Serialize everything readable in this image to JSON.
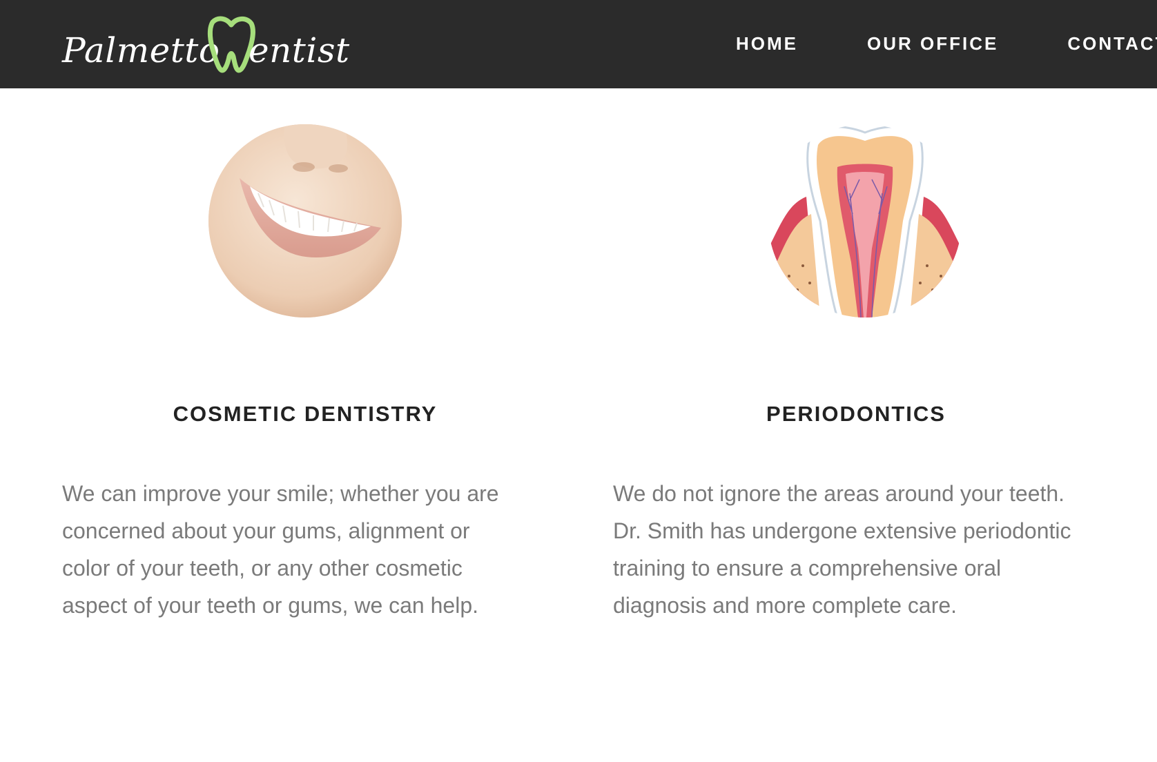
{
  "header": {
    "logo": {
      "text_part1": "Palmetto",
      "text_part2": "entist",
      "icon": "tooth-icon",
      "accent_color": "#a6de7c"
    },
    "nav": [
      {
        "label": "HOME"
      },
      {
        "label": "OUR OFFICE"
      },
      {
        "label": "CONTACT"
      }
    ],
    "background_color": "#2b2b2b"
  },
  "services": [
    {
      "title": "COSMETIC DENTISTRY",
      "image": "smile-image",
      "description_lines": [
        "We can improve your smile; whether you are",
        "concerned about your gums, alignment or",
        "color of your teeth, or any other cosmetic",
        "aspect of your teeth or gums, we can help."
      ]
    },
    {
      "title": "PERIODONTICS",
      "image": "tooth-cross-section-image",
      "description_lines": [
        "We do not ignore the areas around your teeth.",
        "Dr. Smith has undergone extensive periodontic",
        "training to ensure a comprehensive oral",
        "diagnosis and more complete care."
      ]
    }
  ]
}
